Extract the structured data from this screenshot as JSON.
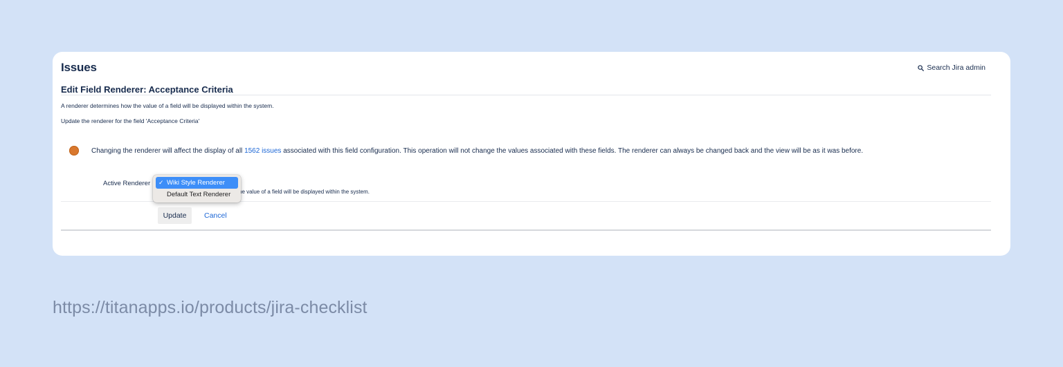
{
  "header": {
    "title": "Issues",
    "search_label": "Search Jira admin",
    "search_icon": "search-icon"
  },
  "section": {
    "title": "Edit Field Renderer: Acceptance Criteria",
    "description": "A renderer determines how the value of a field will be displayed within the system.",
    "update_note": "Update the renderer for the field 'Acceptance Criteria'"
  },
  "warning": {
    "icon": "warning-dot-icon",
    "color": "#d9782e",
    "text_before": "Changing the renderer will affect the display of all ",
    "link_text": "1562 issues",
    "text_after": " associated with this field configuration. This operation will not change the values associated with these fields. The renderer can always be changed back and the view will be as it was before."
  },
  "form": {
    "field_label": "Active Renderer",
    "help_text_visible": "he value of a field will be displayed within the system.",
    "options": [
      {
        "label": "Wiki Style Renderer",
        "selected": true
      },
      {
        "label": "Default Text Renderer",
        "selected": false
      }
    ],
    "check_mark": "✓",
    "update_label": "Update",
    "cancel_label": "Cancel"
  },
  "colors": {
    "background": "#d3e2f7",
    "link": "#1b66d6",
    "selected_option": "#3d8ef8"
  },
  "footer": {
    "url": "https://titanapps.io/products/jira-checklist"
  }
}
